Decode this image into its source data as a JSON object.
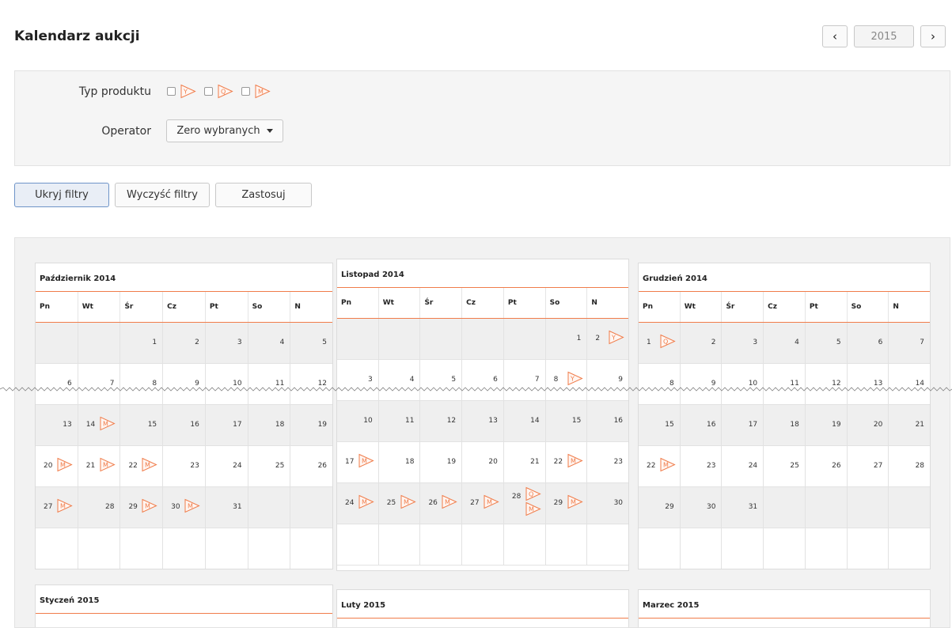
{
  "header": {
    "title": "Kalendarz aukcji",
    "year": "2015",
    "prev_icon": "chevron-left-icon",
    "next_icon": "chevron-right-icon",
    "prev_label": "‹",
    "next_label": "›"
  },
  "filters": {
    "product_label": "Typ produktu",
    "product_types": [
      {
        "letter": "Y"
      },
      {
        "letter": "Q"
      },
      {
        "letter": "M"
      }
    ],
    "operator_label": "Operator",
    "operator_value": "Zero wybranych"
  },
  "buttons": {
    "hide": "Ukryj filtry",
    "clear": "Wyczyść filtry",
    "apply": "Zastosuj"
  },
  "colors": {
    "accent": "#f07c4a",
    "active_border": "#6e94c8"
  },
  "weekdays": [
    "Pn",
    "Wt",
    "Śr",
    "Cz",
    "Pt",
    "So",
    "N"
  ],
  "months": [
    {
      "title": "Październik 2014",
      "weeks": [
        [
          null,
          null,
          {
            "d": "1"
          },
          {
            "d": "2"
          },
          {
            "d": "3"
          },
          {
            "d": "4"
          },
          {
            "d": "5"
          }
        ],
        [
          {
            "d": "6"
          },
          {
            "d": "7"
          },
          {
            "d": "8"
          },
          {
            "d": "9"
          },
          {
            "d": "10"
          },
          {
            "d": "11"
          },
          {
            "d": "12"
          }
        ],
        [
          {
            "d": "13"
          },
          {
            "d": "14",
            "icons": [
              "M"
            ]
          },
          {
            "d": "15"
          },
          {
            "d": "16"
          },
          {
            "d": "17"
          },
          {
            "d": "18"
          },
          {
            "d": "19"
          }
        ],
        [
          {
            "d": "20",
            "icons": [
              "M"
            ]
          },
          {
            "d": "21",
            "icons": [
              "M"
            ]
          },
          {
            "d": "22",
            "icons": [
              "M"
            ]
          },
          {
            "d": "23"
          },
          {
            "d": "24"
          },
          {
            "d": "25"
          },
          {
            "d": "26"
          }
        ],
        [
          {
            "d": "27",
            "icons": [
              "M"
            ]
          },
          {
            "d": "28"
          },
          {
            "d": "29",
            "icons": [
              "M"
            ]
          },
          {
            "d": "30",
            "icons": [
              "M"
            ]
          },
          {
            "d": "31"
          },
          null,
          null
        ],
        [
          null,
          null,
          null,
          null,
          null,
          null,
          null
        ]
      ]
    },
    {
      "title": "Listopad 2014",
      "weeks": [
        [
          null,
          null,
          null,
          null,
          null,
          {
            "d": "1"
          },
          {
            "d": "2",
            "icons": [
              "Y"
            ]
          }
        ],
        [
          {
            "d": "3"
          },
          {
            "d": "4"
          },
          {
            "d": "5"
          },
          {
            "d": "6"
          },
          {
            "d": "7"
          },
          {
            "d": "8",
            "icons": [
              "Y"
            ]
          },
          {
            "d": "9"
          }
        ],
        [
          {
            "d": "10"
          },
          {
            "d": "11"
          },
          {
            "d": "12"
          },
          {
            "d": "13"
          },
          {
            "d": "14"
          },
          {
            "d": "15"
          },
          {
            "d": "16"
          }
        ],
        [
          {
            "d": "17",
            "icons": [
              "M"
            ]
          },
          {
            "d": "18"
          },
          {
            "d": "19"
          },
          {
            "d": "20"
          },
          {
            "d": "21"
          },
          {
            "d": "22",
            "icons": [
              "M"
            ]
          },
          {
            "d": "23"
          }
        ],
        [
          {
            "d": "24",
            "icons": [
              "M"
            ]
          },
          {
            "d": "25",
            "icons": [
              "M"
            ]
          },
          {
            "d": "26",
            "icons": [
              "M"
            ]
          },
          {
            "d": "27",
            "icons": [
              "M"
            ]
          },
          {
            "d": "28",
            "icons": [
              "Q",
              "M"
            ]
          },
          {
            "d": "29",
            "icons": [
              "M"
            ]
          },
          {
            "d": "30"
          }
        ],
        [
          null,
          null,
          null,
          null,
          null,
          null,
          null
        ]
      ]
    },
    {
      "title": "Grudzień 2014",
      "weeks": [
        [
          {
            "d": "1",
            "icons": [
              "Q"
            ]
          },
          {
            "d": "2"
          },
          {
            "d": "3"
          },
          {
            "d": "4"
          },
          {
            "d": "5"
          },
          {
            "d": "6"
          },
          {
            "d": "7"
          }
        ],
        [
          {
            "d": "8"
          },
          {
            "d": "9"
          },
          {
            "d": "10"
          },
          {
            "d": "11"
          },
          {
            "d": "12"
          },
          {
            "d": "13"
          },
          {
            "d": "14"
          }
        ],
        [
          {
            "d": "15"
          },
          {
            "d": "16"
          },
          {
            "d": "17"
          },
          {
            "d": "18"
          },
          {
            "d": "19"
          },
          {
            "d": "20"
          },
          {
            "d": "21"
          }
        ],
        [
          {
            "d": "22",
            "icons": [
              "M"
            ]
          },
          {
            "d": "23"
          },
          {
            "d": "24"
          },
          {
            "d": "25"
          },
          {
            "d": "26"
          },
          {
            "d": "27"
          },
          {
            "d": "28"
          }
        ],
        [
          {
            "d": "29"
          },
          {
            "d": "30"
          },
          {
            "d": "31"
          },
          null,
          null,
          null,
          null
        ],
        [
          null,
          null,
          null,
          null,
          null,
          null,
          null
        ]
      ]
    },
    {
      "title": "Styczeń 2015",
      "weeks": []
    },
    {
      "title": "Luty 2015",
      "weeks": []
    },
    {
      "title": "Marzec 2015",
      "weeks": []
    }
  ]
}
